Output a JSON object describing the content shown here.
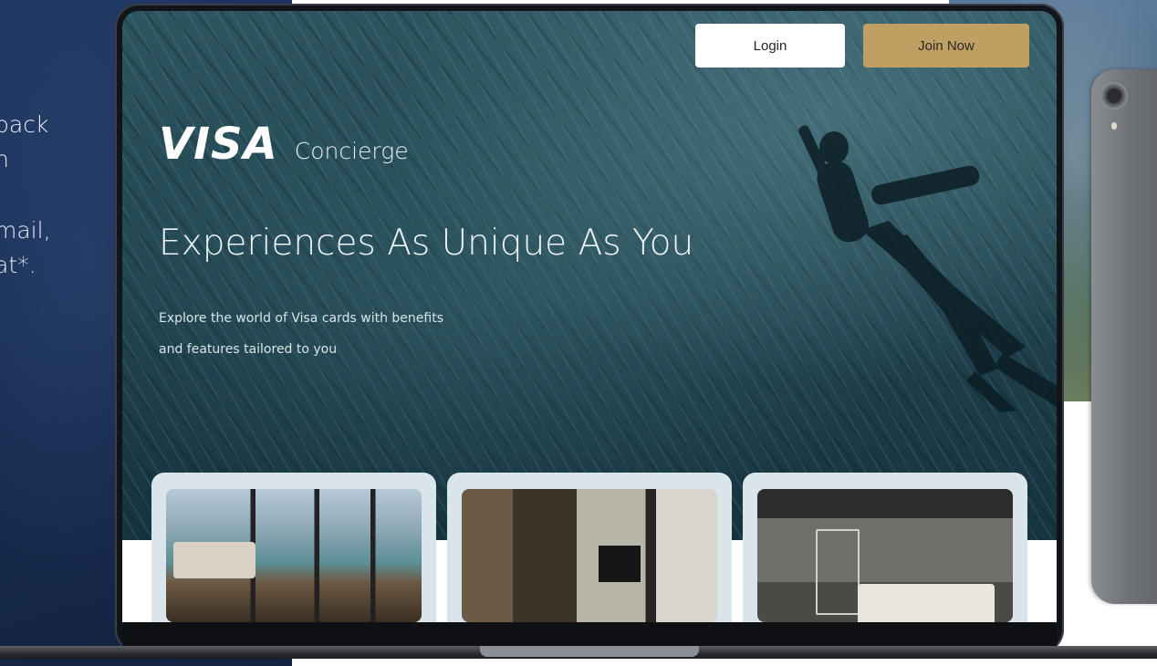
{
  "left_panel": {
    "lines": [
      "back",
      "h",
      "mail,",
      "at*."
    ]
  },
  "site": {
    "brand_logo_text": "VISA",
    "brand_suffix": "Concierge",
    "login_label": "Login",
    "join_label": "Join Now",
    "headline": "Experiences As Unique As You",
    "subtext_line1": "Explore the world of Visa cards with benefits",
    "subtext_line2": "and features tailored to you"
  },
  "colors": {
    "join_button": "#bfa062",
    "login_button": "#ffffff",
    "left_panel": "#1f3863"
  },
  "icons": [
    "tablet-camera-icon",
    "tablet-flash-icon"
  ]
}
